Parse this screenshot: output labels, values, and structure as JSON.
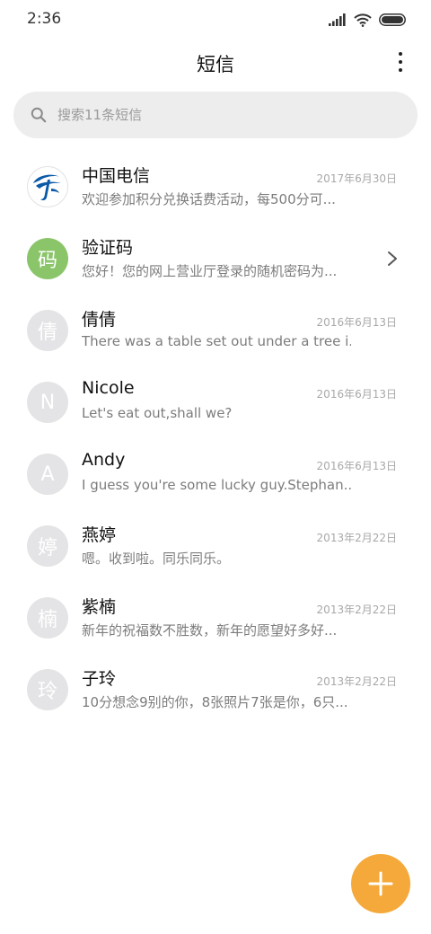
{
  "status_bar": {
    "time": "2:36",
    "icons": [
      "signal-icon",
      "wifi-icon",
      "battery-icon"
    ]
  },
  "header": {
    "title": "短信",
    "more_icon": "more-vertical-icon"
  },
  "search": {
    "placeholder": "搜索11条短信",
    "icon": "search-icon"
  },
  "conversations": [
    {
      "name": "中国电信",
      "preview": "欢迎参加积分兑换话费活动，每500分可...",
      "date": "2017年6月30日",
      "avatar_text": "",
      "avatar_kind": "china-telecom-logo"
    },
    {
      "name": "验证码",
      "preview": "您好！您的网上营业厅登录的随机密码为...",
      "date": "",
      "avatar_text": "码",
      "avatar_kind": "green",
      "has_chevron": true
    },
    {
      "name": "倩倩",
      "preview": "There was a table set out under a tree i...",
      "date": "2016年6月13日",
      "avatar_text": "倩",
      "avatar_kind": "gray"
    },
    {
      "name": "Nicole",
      "preview": "Let's eat out,shall we?",
      "date": "2016年6月13日",
      "avatar_text": "N",
      "avatar_kind": "gray"
    },
    {
      "name": "Andy",
      "preview": "I guess you're some lucky guy.Stephan...",
      "date": "2016年6月13日",
      "avatar_text": "A",
      "avatar_kind": "gray"
    },
    {
      "name": "燕婷",
      "preview": "嗯。收到啦。同乐同乐。",
      "date": "2013年2月22日",
      "avatar_text": "婷",
      "avatar_kind": "gray"
    },
    {
      "name": "紫楠",
      "preview": "新年的祝福数不胜数，新年的愿望好多好...",
      "date": "2013年2月22日",
      "avatar_text": "楠",
      "avatar_kind": "gray"
    },
    {
      "name": "子玲",
      "preview": "10分想念9别的你，8张照片7张是你，6只...",
      "date": "2013年2月22日",
      "avatar_text": "玲",
      "avatar_kind": "gray"
    }
  ],
  "fab": {
    "icon": "plus-icon"
  },
  "colors": {
    "accent": "#f5a93a",
    "avatar_green": "#8bc56a",
    "avatar_gray": "#e4e4e6",
    "search_bg": "#ededed",
    "telecom_blue": "#0b5aa8"
  }
}
